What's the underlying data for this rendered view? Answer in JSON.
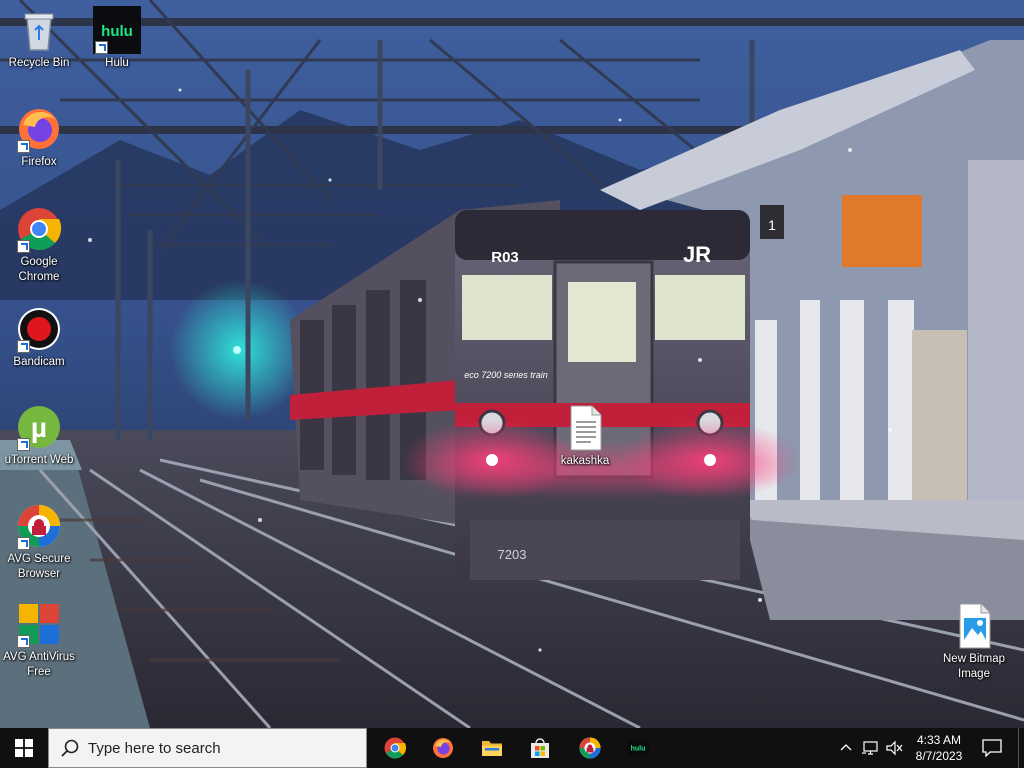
{
  "desktop": {
    "icons": [
      {
        "label": "Recycle Bin"
      },
      {
        "label": "Hulu"
      },
      {
        "label": "Firefox"
      },
      {
        "label": "Google Chrome"
      },
      {
        "label": "Bandicam"
      },
      {
        "label": "uTorrent Web"
      },
      {
        "label": "AVG Secure Browser"
      },
      {
        "label": "AVG AntiVirus Free"
      },
      {
        "label": "kakashka"
      },
      {
        "label": "New Bitmap Image"
      }
    ]
  },
  "wallpaper": {
    "train_destination": "R03",
    "train_logo": "JR",
    "train_series": "eco 7200 series train",
    "train_number": "7203",
    "platform_sign": "1"
  },
  "taskbar": {
    "search_placeholder": "Type here to search",
    "apps": [
      {
        "name": "Google Chrome",
        "icon": "chrome-icon"
      },
      {
        "name": "Firefox",
        "icon": "firefox-icon"
      },
      {
        "name": "File Explorer",
        "icon": "folder-icon"
      },
      {
        "name": "Microsoft Store",
        "icon": "store-icon"
      },
      {
        "name": "AVG Secure Browser",
        "icon": "avg-browser-icon"
      },
      {
        "name": "Hulu",
        "icon": "hulu-icon",
        "text": "hulu"
      }
    ],
    "tray": {
      "icons": [
        "chevron-up-icon",
        "network-icon",
        "volume-muted-icon"
      ]
    },
    "clock": {
      "time": "4:33 AM",
      "date": "8/7/2023"
    }
  },
  "colors": {
    "taskbar_bg": "#101010",
    "search_bg": "#f3f3f3",
    "hulu_green": "#1ce783",
    "train_red": "#c0203a"
  }
}
